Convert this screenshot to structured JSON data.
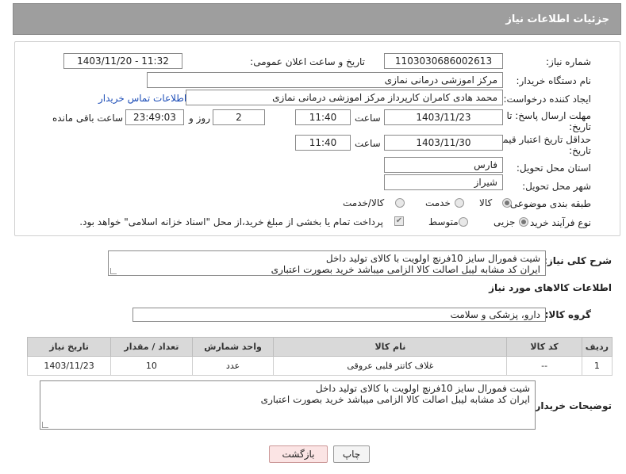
{
  "header": {
    "title": "جزئیات اطلاعات نیاز"
  },
  "form": {
    "need_number_label": "شماره نیاز:",
    "need_number": "1103030686002613",
    "announce_label": "تاریخ و ساعت اعلان عمومی:",
    "announce_value": "1403/11/20 - 11:32",
    "buyer_label": "نام دستگاه خریدار:",
    "buyer_value": "مرکز اموزشی درمانی نمازی",
    "creator_label": "ایجاد کننده درخواست:",
    "creator_value": "محمد هادی کامران کارپرداز مرکز اموزشی درمانی نمازی",
    "contact_link": "اطلاعات تماس خریدار",
    "deadline_label": "مهلت ارسال پاسخ: تا",
    "deadline_label2": "تاریخ:",
    "deadline_date": "1403/11/23",
    "time_label": "ساعت",
    "deadline_time": "11:40",
    "days_value": "2",
    "days_label": "روز و",
    "remaining_time": "23:49:03",
    "remaining_label": "ساعت باقی مانده",
    "validity_label": "حداقل تاریخ اعتبار قیمت: تا",
    "validity_label2": "تاریخ:",
    "validity_date": "1403/11/30",
    "validity_time": "11:40",
    "province_label": "استان محل تحویل:",
    "province_value": "فارس",
    "city_label": "شهر محل تحویل:",
    "city_value": "شیراز",
    "category_label": "طبقه بندی موضوعی:",
    "category_options": [
      "کالا",
      "خدمت",
      "کالا/خدمت"
    ],
    "process_label": "نوع فرآیند خرید :",
    "process_options": [
      "جزیی",
      "متوسط"
    ],
    "payment_note": "پرداخت تمام یا بخشی از مبلغ خرید،از محل \"اسناد خزانه اسلامی\" خواهد بود."
  },
  "summary": {
    "label": "شرح کلی نیاز:",
    "line1": "شیت فمورال سایز 10فرنچ اولویت با کالای تولید داخل",
    "line2": "ایران کد مشابه  لیبل اصالت کالا الزامی میباشد خرید بصورت اعتباری"
  },
  "goods_section_title": "اطلاعات کالاهای مورد نیاز",
  "goods_group": {
    "label": "گروه کالا:",
    "value": "دارو، پزشکی و سلامت"
  },
  "table": {
    "headers": [
      "ردیف",
      "کد کالا",
      "نام کالا",
      "واحد شمارش",
      "تعداد / مقدار",
      "تاریخ نیاز"
    ],
    "rows": [
      [
        "1",
        "--",
        "غلاف کاتتر قلبی عروقی",
        "عدد",
        "10",
        "1403/11/23"
      ]
    ]
  },
  "buyer_notes": {
    "label": "توضیحات خریدار:",
    "line1": "شیت فمورال سایز 10فرنچ اولویت با کالای تولید داخل",
    "line2": "ایران کد مشابه  لیبل اصالت کالا الزامی میباشد خرید بصورت اعتباری"
  },
  "buttons": {
    "print": "چاپ",
    "back": "بازگشت"
  },
  "colors": {
    "header_bg": "#9e9e9e",
    "link": "#1f4fb8",
    "back_button": "#fbe4e4"
  }
}
